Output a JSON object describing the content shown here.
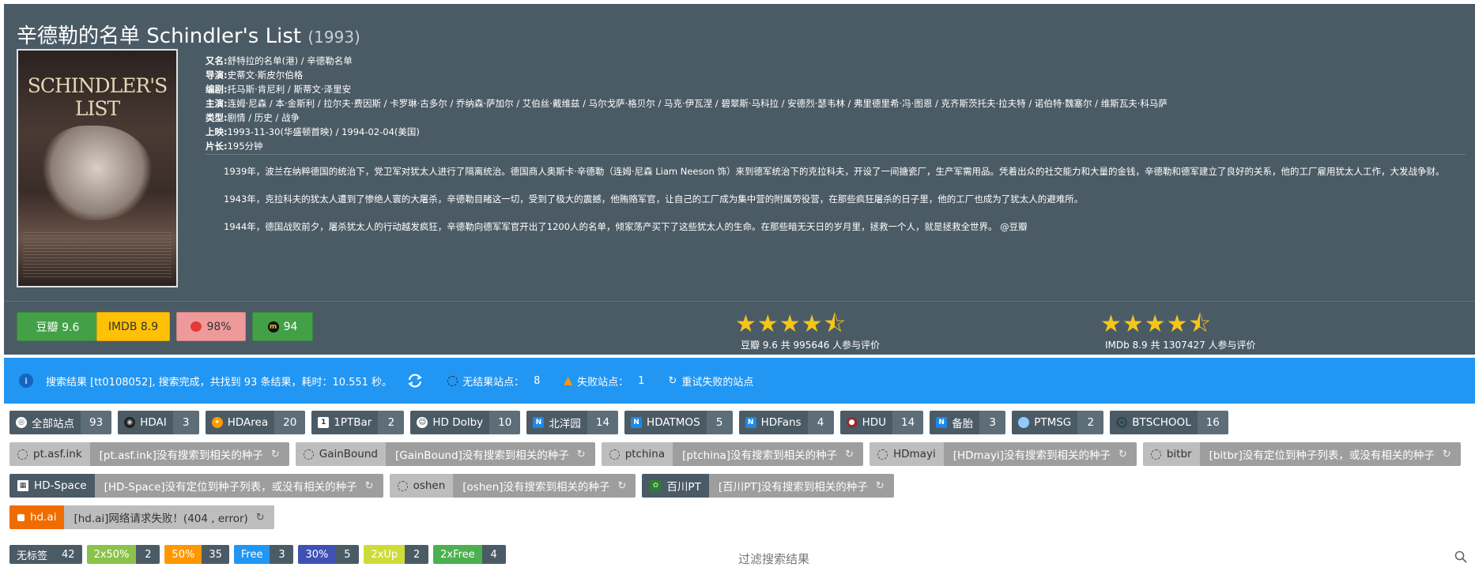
{
  "movie": {
    "title": "辛德勒的名单 Schindler's List",
    "year": "(1993)",
    "poster_text": "SCHINDLER'S LIST",
    "meta": [
      {
        "label": "又名:",
        "value": "舒特拉的名单(港) / 辛德勒名单"
      },
      {
        "label": "导演:",
        "value": "史蒂文·斯皮尔伯格"
      },
      {
        "label": "编剧:",
        "value": "托马斯·肯尼利 / 斯蒂文·泽里安"
      },
      {
        "label": "主演:",
        "value": "连姆·尼森 / 本·金斯利 / 拉尔夫·费因斯 / 卡罗琳·古多尔 / 乔纳森·萨加尔 / 艾伯丝·戴维兹 / 马尔戈萨·格贝尔 / 马克·伊瓦涅 / 碧翠斯·马科拉 / 安德烈·瑟韦林 / 弗里德里希·冯·图恩 / 克齐斯茨托夫·拉夫特 / 诺伯特·魏塞尔 / 维斯瓦夫·科马萨"
      },
      {
        "label": "类型:",
        "value": "剧情 / 历史 / 战争"
      },
      {
        "label": "上映:",
        "value": "1993-11-30(华盛顿首映) / 1994-02-04(美国)"
      },
      {
        "label": "片长:",
        "value": "195分钟"
      }
    ],
    "description": [
      "1939年，波兰在纳粹德国的统治下，党卫军对犹太人进行了隔离统治。德国商人奥斯卡·辛德勒（连姆·尼森 Liam Neeson 饰）来到德军统治下的克拉科夫，开设了一间搪瓷厂，生产军需用品。凭着出众的社交能力和大量的金钱，辛德勒和德军建立了良好的关系，他的工厂雇用犹太人工作，大发战争财。",
      "1943年，克拉科夫的犹太人遭到了惨绝人寰的大屠杀，辛德勒目睹这一切，受到了极大的震撼，他贿赂军官，让自己的工厂成为集中营的附属劳役营，在那些疯狂屠杀的日子里，他的工厂也成为了犹太人的避难所。",
      "1944年，德国战败前夕，屠杀犹太人的行动越发疯狂，辛德勒向德军军官开出了1200人的名单，倾家荡产买下了这些犹太人的生命。在那些暗无天日的岁月里，拯救一个人，就是拯救全世界。 @豆瓣"
    ]
  },
  "ratings": {
    "buttons": [
      {
        "label": "豆瓣 9.6",
        "bg": "#43a047",
        "fg": "#ffffff"
      },
      {
        "label": "IMDB 8.9",
        "bg": "#ffc107",
        "fg": "#333333"
      },
      {
        "label": "98%",
        "bg": "#ef9a9a",
        "fg": "#333333",
        "icon": "tomato-icon"
      },
      {
        "label": "94",
        "bg": "#43a047",
        "fg": "#ffffff",
        "icon": "metacritic-icon"
      }
    ],
    "douban": {
      "stars": "★★★★⯪",
      "label": "豆瓣 9.6 共 995646 人参与评价"
    },
    "imdb": {
      "stars": "★★★★⯪",
      "label": "IMDb 8.9 共 1307427 人参与评价"
    }
  },
  "search": {
    "result_text": "搜索结果 [tt0108052], 搜索完成，共找到 93 条结果，耗时：10.551 秒。",
    "no_result_label": "无结果站点：",
    "no_result_count": "8",
    "failed_label": "失败站点：",
    "failed_count": "1",
    "retry_label": "重试失败的站点"
  },
  "sites": [
    {
      "name": "全部站点",
      "count": "93",
      "icon": "globe-icon"
    },
    {
      "name": "HDAI",
      "count": "3",
      "icon": "hdai-icon"
    },
    {
      "name": "HDArea",
      "count": "20",
      "icon": "hdarea-icon"
    },
    {
      "name": "1PTBar",
      "count": "2",
      "icon": "1ptbar-icon"
    },
    {
      "name": "HD Dolby",
      "count": "10",
      "icon": "hddolby-icon"
    },
    {
      "name": "北洋园",
      "count": "14",
      "icon": "n-icon"
    },
    {
      "name": "HDATMOS",
      "count": "5",
      "icon": "n-icon"
    },
    {
      "name": "HDFans",
      "count": "4",
      "icon": "n-icon"
    },
    {
      "name": "HDU",
      "count": "14",
      "icon": "hdu-icon"
    },
    {
      "name": "备胎",
      "count": "3",
      "icon": "n-icon"
    },
    {
      "name": "PTMSG",
      "count": "2",
      "icon": "ptmsg-icon"
    },
    {
      "name": "BTSCHOOL",
      "count": "16",
      "icon": "btschool-icon"
    }
  ],
  "empty_sites_row1": [
    {
      "name": "pt.asf.ink",
      "msg": "[pt.asf.ink]没有搜索到相关的种子"
    },
    {
      "name": "GainBound",
      "msg": "[GainBound]没有搜索到相关的种子"
    },
    {
      "name": "ptchina",
      "msg": "[ptchina]没有搜索到相关的种子"
    },
    {
      "name": "HDmayi",
      "msg": "[HDmayi]没有搜索到相关的种子"
    },
    {
      "name": "bitbr",
      "msg": "[bitbr]没有定位到种子列表，或没有相关的种子"
    }
  ],
  "empty_sites_row2": [
    {
      "name": "HD-Space",
      "msg": "[HD-Space]没有定位到种子列表，或没有相关的种子"
    },
    {
      "name": "oshen",
      "msg": "[oshen]没有搜索到相关的种子"
    },
    {
      "name": "百川PT",
      "msg": "[百川PT]没有搜索到相关的种子"
    }
  ],
  "failed_site": {
    "name": "hd.ai",
    "msg": "[hd.ai]网络请求失败！(404 , error)"
  },
  "tags": [
    {
      "name": "无标签",
      "count": "42",
      "bg": "#4b5b66"
    },
    {
      "name": "2x50%",
      "count": "2",
      "bg": "#8bc34a"
    },
    {
      "name": "50%",
      "count": "35",
      "bg": "#ff9800"
    },
    {
      "name": "Free",
      "count": "3",
      "bg": "#2196f3"
    },
    {
      "name": "30%",
      "count": "5",
      "bg": "#3f51b5"
    },
    {
      "name": "2xUp",
      "count": "2",
      "bg": "#cddc39"
    },
    {
      "name": "2xFree",
      "count": "4",
      "bg": "#4caf50"
    }
  ],
  "filter": {
    "placeholder": "过滤搜索结果"
  }
}
